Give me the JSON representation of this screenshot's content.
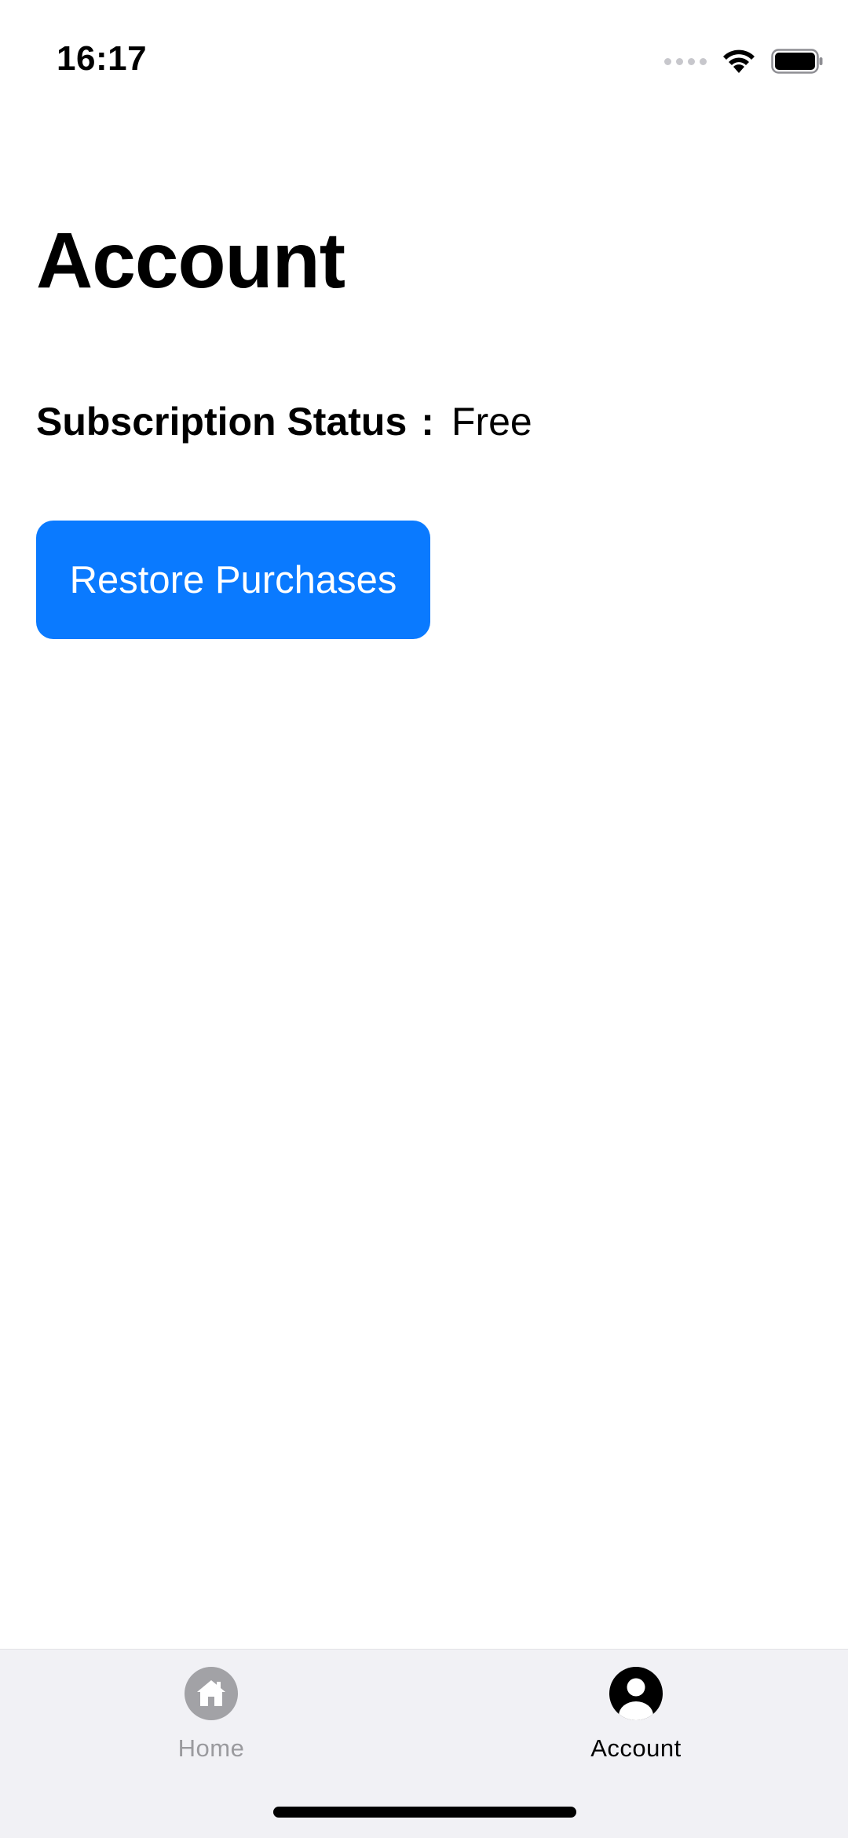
{
  "status_bar": {
    "time": "16:17",
    "icons": [
      "cellular-signal-icon",
      "wifi-icon",
      "battery-icon"
    ]
  },
  "page": {
    "title": "Account"
  },
  "subscription": {
    "label": "Subscription Status",
    "separator": ":",
    "value": "Free"
  },
  "actions": {
    "restore_label": "Restore Purchases"
  },
  "tab_bar": {
    "tabs": [
      {
        "label": "Home",
        "icon": "home-icon",
        "selected": false
      },
      {
        "label": "Account",
        "icon": "person-icon",
        "selected": true
      }
    ]
  },
  "colors": {
    "accent": "#0a7aff",
    "tab_bar_background": "#f1f1f5",
    "inactive_tab": "#9a9a9e",
    "active_tab": "#000000"
  }
}
